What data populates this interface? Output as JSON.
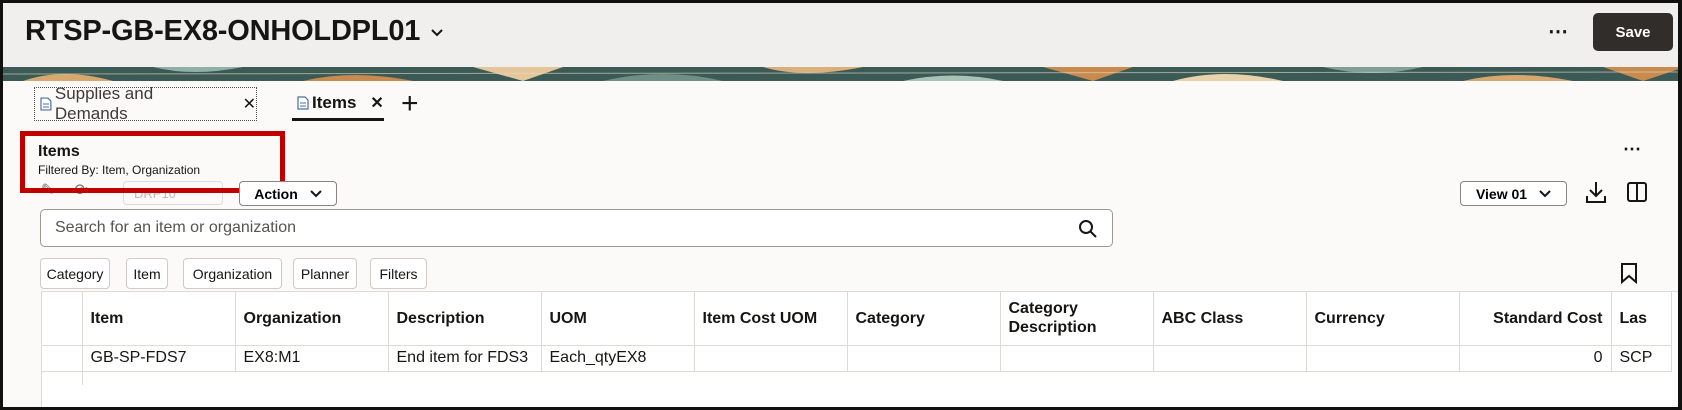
{
  "header": {
    "title": "RTSP-GB-EX8-ONHOLDPL01",
    "more_label": "⋯",
    "save_label": "Save"
  },
  "tabs": [
    {
      "label": "Supplies and Demands",
      "close": "✕"
    },
    {
      "label": "Items",
      "close": "✕"
    }
  ],
  "add_tab_label": "+",
  "panel": {
    "title": "Items",
    "subtitle": "Filtered By: Item, Organization",
    "more_label": "⋯",
    "dimmed_select": "DRP10",
    "action_label": "Action",
    "view_label": "View 01"
  },
  "search": {
    "placeholder": "Search for an item or organization"
  },
  "filter_chips": [
    "Category",
    "Item",
    "Organization",
    "Planner",
    "Filters"
  ],
  "table": {
    "columns": [
      "Item",
      "Organization",
      "Description",
      "UOM",
      "Item Cost UOM",
      "Category",
      "Category Description",
      "ABC Class",
      "Currency",
      "Standard Cost",
      "Las"
    ],
    "rows": [
      [
        "GB-SP-FDS7",
        "EX8:M1",
        "End item for FDS3",
        "Each_qtyEX8",
        "",
        "",
        "",
        "",
        "",
        "0",
        "SCP"
      ]
    ]
  },
  "colors": {
    "accent_dark": "#312d2a",
    "highlight_red": "#c00000",
    "header_bg": "#f1efed"
  }
}
